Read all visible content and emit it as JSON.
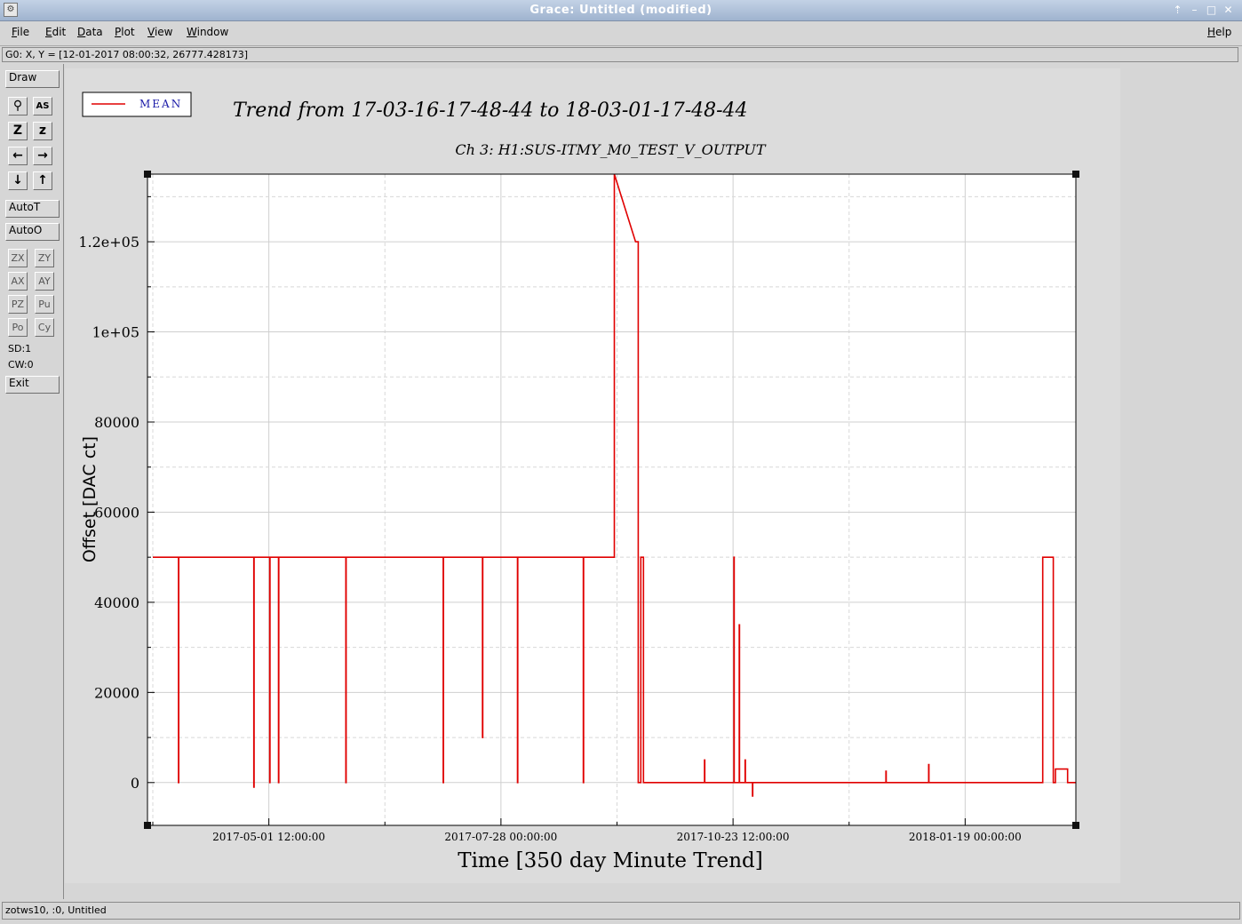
{
  "window": {
    "title": "Grace: Untitled (modified)",
    "controls": [
      "⇡",
      "–",
      "□",
      "✕"
    ]
  },
  "menu": {
    "file": "File",
    "edit": "Edit",
    "data": "Data",
    "plot": "Plot",
    "view": "View",
    "window": "Window",
    "help": "Help"
  },
  "coord_readout": "G0: X, Y = [12-01-2017 08:00:32, 26777.428173]",
  "tools": {
    "draw": "Draw",
    "autot": "AutoT",
    "autoo": "AutoO",
    "zx": "ZX",
    "zy": "ZY",
    "ax": "AX",
    "ay": "AY",
    "pz": "PZ",
    "pu": "Pu",
    "po": "Po",
    "cy": "Cy",
    "sd": "SD:1",
    "cw": "CW:0",
    "exit": "Exit",
    "icons": [
      "magnifier-icon",
      "autoscale-text-icon",
      "zoom-z-icon",
      "zoom-z-bold-icon",
      "arrow-left-icon",
      "arrow-right-icon",
      "arrow-down-icon",
      "arrow-up-icon"
    ],
    "icon_glyphs": [
      "⚲",
      "AS",
      "Z",
      "z",
      "←",
      "→",
      "↓",
      "↑"
    ]
  },
  "status": "zotws10, :0, Untitled",
  "chart_data": {
    "type": "line",
    "title": "Trend from 17-03-16-17-48-44 to 18-03-01-17-48-44",
    "subtitle": "Ch 3: H1:SUS-ITMY_M0_TEST_V_OUTPUT",
    "xlabel": "Time [350 day Minute Trend]",
    "ylabel": "Offset [DAC ct]",
    "x_unit": "days",
    "xlim": [
      0,
      350
    ],
    "ylim": [
      -9500,
      135000
    ],
    "x_ticks": [
      {
        "value": 45.76,
        "label": "2017-05-01 12:00:00"
      },
      {
        "value": 133.26,
        "label": "2017-07-28 00:00:00"
      },
      {
        "value": 220.76,
        "label": "2017-10-23 12:00:00"
      },
      {
        "value": 308.26,
        "label": "2018-01-19 00:00:00"
      }
    ],
    "y_ticks": [
      {
        "value": 0,
        "label": "0"
      },
      {
        "value": 20000,
        "label": "20000"
      },
      {
        "value": 40000,
        "label": "40000"
      },
      {
        "value": 60000,
        "label": "60000"
      },
      {
        "value": 80000,
        "label": "80000"
      },
      {
        "value": 100000,
        "label": "1e+05"
      },
      {
        "value": 120000,
        "label": "1.2e+05"
      }
    ],
    "grid": true,
    "color": "#e00000",
    "legend": {
      "position": "top-left",
      "entries": [
        {
          "label": "MEAN",
          "color": "#e00000"
        }
      ]
    },
    "series": [
      {
        "name": "MEAN",
        "x": [
          2,
          11.7,
          11.7,
          11.8,
          11.8,
          40.1,
          40.1,
          40.2,
          40.2,
          46.1,
          46.1,
          46.2,
          46.2,
          49.4,
          49.4,
          49.5,
          49.5,
          74.8,
          74.8,
          74.9,
          74.9,
          111.5,
          111.5,
          111.6,
          111.6,
          126.3,
          126.3,
          126.4,
          126.4,
          139.5,
          139.5,
          139.6,
          139.6,
          164.3,
          164.3,
          164.4,
          164.4,
          176.0,
          176.0,
          184.0,
          184.0,
          185.0,
          185.0,
          186.0,
          186.0,
          187.0,
          187.0,
          210.0,
          210.0,
          210.1,
          210.1,
          221.1,
          221.1,
          221.2,
          221.2,
          223.1,
          223.1,
          223.2,
          223.2,
          225.3,
          225.3,
          225.4,
          225.4,
          228.1,
          228.1,
          228.2,
          228.2,
          278.4,
          278.4,
          278.5,
          278.5,
          294.5,
          294.5,
          294.6,
          294.6,
          337.5,
          337.5,
          341.5,
          341.5,
          342.3,
          342.3,
          346.9,
          346.9,
          350
        ],
        "y": [
          50000,
          50000,
          0,
          0,
          50000,
          50000,
          -1000,
          -1000,
          50000,
          50000,
          0,
          0,
          50000,
          50000,
          0,
          0,
          50000,
          50000,
          0,
          0,
          50000,
          50000,
          0,
          0,
          50000,
          50000,
          10000,
          10000,
          50000,
          50000,
          0,
          0,
          50000,
          50000,
          0,
          0,
          50000,
          50000,
          135000,
          120000,
          120000,
          120000,
          0,
          0,
          50000,
          50000,
          0,
          0,
          5000,
          5000,
          0,
          0,
          50000,
          50000,
          0,
          0,
          35000,
          35000,
          0,
          0,
          5000,
          5000,
          0,
          0,
          -3000,
          -3000,
          0,
          0,
          2500,
          2500,
          0,
          0,
          4000,
          4000,
          0,
          0,
          50000,
          50000,
          0,
          0,
          3000,
          3000,
          0,
          0
        ]
      }
    ]
  }
}
